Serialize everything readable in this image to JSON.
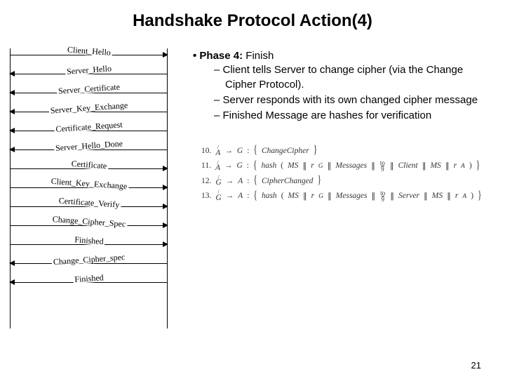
{
  "title": "Handshake Protocol Action(4)",
  "messages": [
    {
      "label": "Client_Hello",
      "dir": "right",
      "tilt": "down"
    },
    {
      "label": "Server_Hello",
      "dir": "left",
      "tilt": "up"
    },
    {
      "label": "Server_Certificate",
      "dir": "left",
      "tilt": "up"
    },
    {
      "label": "Server_Key_Exchange",
      "dir": "left",
      "tilt": "up"
    },
    {
      "label": "Certificate_Request",
      "dir": "left",
      "tilt": "up"
    },
    {
      "label": "Server_Hello_Done",
      "dir": "left",
      "tilt": "up"
    },
    {
      "label": "Certificate",
      "dir": "right",
      "tilt": "down"
    },
    {
      "label": "Client_Key_Exchange",
      "dir": "right",
      "tilt": "down"
    },
    {
      "label": "Certificate_Verify",
      "dir": "right",
      "tilt": "down"
    },
    {
      "label": "Change_Cipher_Spec",
      "dir": "right",
      "tilt": "down"
    },
    {
      "label": "Finished",
      "dir": "right",
      "tilt": "down"
    },
    {
      "label": "Change_Cipher_spec",
      "dir": "left",
      "tilt": "up"
    },
    {
      "label": "Finished",
      "dir": "left",
      "tilt": "up"
    }
  ],
  "bullet_title_bold": "Phase 4:",
  "bullet_title_rest": " Finish",
  "sub_bullets": [
    "Client tells Server to change cipher (via the Change Cipher Protocol).",
    "Server responds with its own changed cipher message",
    "Finished Message are hashes for verification"
  ],
  "equations": [
    {
      "num": "10.",
      "lhs_actor": "A",
      "lhs_arrow": "→",
      "lhs_target": "G",
      "body": "ChangeCipher"
    },
    {
      "num": "11.",
      "lhs_actor": "A",
      "lhs_arrow": "→",
      "lhs_target": "G",
      "hash": true,
      "inner": [
        "MS",
        "r_G",
        "Messages",
        "to9",
        "Client",
        "MS",
        "r_A"
      ]
    },
    {
      "num": "12.",
      "lhs_actor": "G",
      "lhs_arrow": "→",
      "lhs_target": "A",
      "body": "CipherChanged"
    },
    {
      "num": "13.",
      "lhs_actor": "G",
      "lhs_arrow": "→",
      "lhs_target": "A",
      "hash": true,
      "inner": [
        "MS",
        "r_G",
        "Messages",
        "to9",
        "Server",
        "MS",
        "r_A"
      ]
    }
  ],
  "slide_number": "21"
}
